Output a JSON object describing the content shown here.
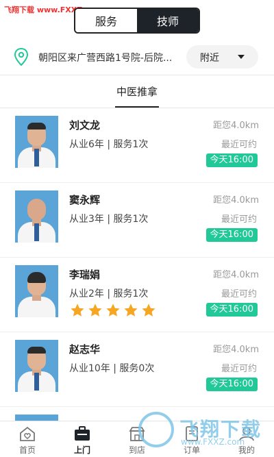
{
  "watermark_top": "飞翔下载 www.FXXZ.com",
  "segment": {
    "service": "服务",
    "technician": "技师"
  },
  "location": {
    "address": "朝阳区来广营西路1号院-后院...",
    "nearby": "附近"
  },
  "category_tab": "中医推拿",
  "doctors": [
    {
      "name": "刘文龙",
      "meta": "从业6年 | 服务1次",
      "distance": "距您4.0km",
      "recent": "最近可约",
      "time": "今天16:00",
      "rating": 0
    },
    {
      "name": "窦永辉",
      "meta": "从业3年 | 服务1次",
      "distance": "距您4.0km",
      "recent": "最近可约",
      "time": "今天16:00",
      "rating": 0
    },
    {
      "name": "李瑞娟",
      "meta": "从业2年 | 服务1次",
      "distance": "距您4.0km",
      "recent": "最近可约",
      "time": "今天16:00",
      "rating": 5
    },
    {
      "name": "赵志华",
      "meta": "从业10年 | 服务0次",
      "distance": "距您4.0km",
      "recent": "最近可约",
      "time": "今天16:00",
      "rating": 0
    }
  ],
  "tabbar": {
    "home": "首页",
    "visit": "上门",
    "store": "到店",
    "orders": "订单",
    "mine": "我的"
  },
  "watermark_br": {
    "brand": "飞翔下载",
    "url": "www.FXXZ.com"
  },
  "colors": {
    "accent": "#20c997",
    "star": "#f5a623",
    "dark": "#1e2229"
  }
}
